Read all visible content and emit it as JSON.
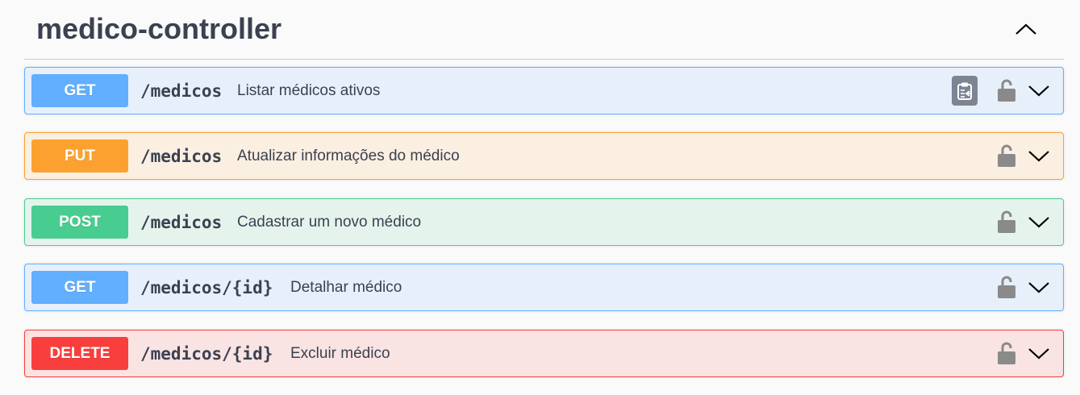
{
  "tag": {
    "title": "medico-controller",
    "collapse_icon": "chevron-up-icon"
  },
  "operations": [
    {
      "method": "GET",
      "path": "/medicos",
      "summary": "Listar médicos ativos",
      "color": "#61affe",
      "has_copy_button": true
    },
    {
      "method": "PUT",
      "path": "/medicos",
      "summary": "Atualizar informações do médico",
      "color": "#fca130"
    },
    {
      "method": "POST",
      "path": "/medicos",
      "summary": "Cadastrar um novo médico",
      "color": "#49cc90"
    },
    {
      "method": "GET",
      "path": "/medicos/{id}",
      "summary": "Detalhar médico",
      "color": "#61affe"
    },
    {
      "method": "DELETE",
      "path": "/medicos/{id}",
      "summary": "Excluir médico",
      "color": "#f93e3e"
    }
  ],
  "icons": {
    "lock": "unlocked-padlock-icon",
    "expand": "chevron-down-icon",
    "copy": "clipboard-copy-icon"
  }
}
